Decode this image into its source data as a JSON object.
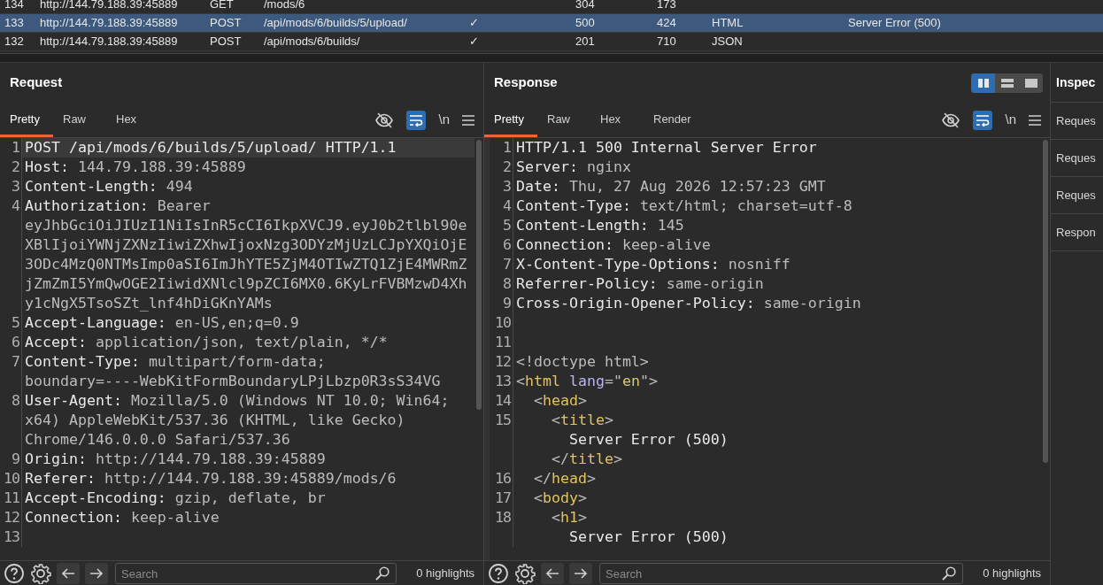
{
  "history": {
    "rows": [
      {
        "number": "134",
        "host": "http://144.79.188.39:45889",
        "method": "GET",
        "url": "/mods/6",
        "status": "304",
        "length": "173",
        "selected": false
      },
      {
        "number": "133",
        "host": "http://144.79.188.39:45889",
        "method": "POST",
        "url": "/api/mods/6/builds/5/upload/",
        "column_5": "✓",
        "status": "500",
        "length": "424",
        "mime": "HTML",
        "title": "Server Error (500)",
        "selected": true
      },
      {
        "number": "132",
        "host": "http://144.79.188.39:45889",
        "method": "POST",
        "url": "/api/mods/6/builds/",
        "column_5": "✓",
        "status": "201",
        "length": "710",
        "mime": "JSON",
        "selected": false
      }
    ]
  },
  "request": {
    "title": "Request",
    "tabs": [
      {
        "label": "Pretty",
        "selected": true
      },
      {
        "label": "Raw",
        "selected": false
      },
      {
        "label": "Hex",
        "selected": false
      }
    ],
    "toolbar": {
      "wrap_on": true,
      "newline_label": "\\n"
    },
    "lines": [
      {
        "number": "1",
        "highlighted": true,
        "rows": [
          {
            "parts": [
              {
                "kind": "plain",
                "text": "POST /api/mods/6/builds/5/upload/ HTTP/1.1"
              }
            ]
          }
        ]
      },
      {
        "number": "2",
        "highlighted": false,
        "rows": [
          {
            "parts": [
              {
                "kind": "name",
                "text": "Host: "
              },
              {
                "kind": "value",
                "text": "144.79.188.39:45889"
              }
            ]
          }
        ]
      },
      {
        "number": "3",
        "highlighted": false,
        "rows": [
          {
            "parts": [
              {
                "kind": "name",
                "text": "Content-Length: "
              },
              {
                "kind": "value",
                "text": "494"
              }
            ]
          }
        ]
      },
      {
        "number": "4",
        "highlighted": false,
        "rows": [
          {
            "parts": [
              {
                "kind": "name",
                "text": "Authorization: "
              },
              {
                "kind": "value",
                "text": "Bearer"
              }
            ]
          },
          {
            "parts": [
              {
                "kind": "value",
                "text": "eyJhbGciOiJIUzI1NiIsInR5cCI6IkpXVCJ9.eyJ0b2tlbl90e"
              }
            ]
          },
          {
            "parts": [
              {
                "kind": "value",
                "text": "XBlIjoiYWNjZXNzIiwiZXhwIjoxNzg3ODYzMjUzLCJpYXQiOjE"
              }
            ]
          },
          {
            "parts": [
              {
                "kind": "value",
                "text": "3ODc4MzQ0NTMsImp0aSI6ImJhYTE5ZjM4OTIwZTQ1ZjE4MWRmZ"
              }
            ]
          },
          {
            "parts": [
              {
                "kind": "value",
                "text": "jZmZmI5YmQwOGE2IiwidXNlcl9pZCI6MX0.6KyLrFVBMzwD4Xh"
              }
            ]
          },
          {
            "parts": [
              {
                "kind": "value",
                "text": "y1cNgX5TsoSZt_lnf4hDiGKnYAMs"
              }
            ]
          }
        ]
      },
      {
        "number": "5",
        "highlighted": false,
        "rows": [
          {
            "parts": [
              {
                "kind": "name",
                "text": "Accept-Language: "
              },
              {
                "kind": "value",
                "text": "en-US,en;q=0.9"
              }
            ]
          }
        ]
      },
      {
        "number": "6",
        "highlighted": false,
        "rows": [
          {
            "parts": [
              {
                "kind": "name",
                "text": "Accept: "
              },
              {
                "kind": "value",
                "text": "application/json, text/plain, */*"
              }
            ]
          }
        ]
      },
      {
        "number": "7",
        "highlighted": false,
        "rows": [
          {
            "parts": [
              {
                "kind": "name",
                "text": "Content-Type: "
              },
              {
                "kind": "value",
                "text": "multipart/form-data;"
              }
            ]
          },
          {
            "parts": [
              {
                "kind": "value",
                "text": "boundary=----WebKitFormBoundaryLPjLbzp0R3sS34VG"
              }
            ]
          }
        ]
      },
      {
        "number": "8",
        "highlighted": false,
        "rows": [
          {
            "parts": [
              {
                "kind": "name",
                "text": "User-Agent: "
              },
              {
                "kind": "value",
                "text": "Mozilla/5.0 (Windows NT 10.0; Win64;"
              }
            ]
          },
          {
            "parts": [
              {
                "kind": "value",
                "text": "x64) AppleWebKit/537.36 (KHTML, like Gecko)"
              }
            ]
          },
          {
            "parts": [
              {
                "kind": "value",
                "text": "Chrome/146.0.0.0 Safari/537.36"
              }
            ]
          }
        ]
      },
      {
        "number": "9",
        "highlighted": false,
        "rows": [
          {
            "parts": [
              {
                "kind": "name",
                "text": "Origin: "
              },
              {
                "kind": "value",
                "text": "http://144.79.188.39:45889"
              }
            ]
          }
        ]
      },
      {
        "number": "10",
        "highlighted": false,
        "rows": [
          {
            "parts": [
              {
                "kind": "name",
                "text": "Referer: "
              },
              {
                "kind": "value",
                "text": "http://144.79.188.39:45889/mods/6"
              }
            ]
          }
        ]
      },
      {
        "number": "11",
        "highlighted": false,
        "rows": [
          {
            "parts": [
              {
                "kind": "name",
                "text": "Accept-Encoding: "
              },
              {
                "kind": "value",
                "text": "gzip, deflate, br"
              }
            ]
          }
        ]
      },
      {
        "number": "12",
        "highlighted": false,
        "rows": [
          {
            "parts": [
              {
                "kind": "name",
                "text": "Connection: "
              },
              {
                "kind": "value",
                "text": "keep-alive"
              }
            ]
          }
        ]
      },
      {
        "number": "13",
        "highlighted": false,
        "rows": [
          {}
        ]
      }
    ],
    "search": {
      "placeholder": "Search"
    },
    "highlights": "0 highlights"
  },
  "response": {
    "title": "Response",
    "layout_options": [
      {
        "kind": "columns",
        "selected": true
      },
      {
        "kind": "rows",
        "selected": false
      },
      {
        "kind": "single",
        "selected": false
      }
    ],
    "tabs": [
      {
        "label": "Pretty",
        "selected": true
      },
      {
        "label": "Raw",
        "selected": false
      },
      {
        "label": "Hex",
        "selected": false
      },
      {
        "label": "Render",
        "selected": false
      }
    ],
    "toolbar": {
      "wrap_on": true,
      "newline_label": "\\n"
    },
    "lines": [
      {
        "number": "1",
        "highlighted": false,
        "rows": [
          {
            "parts": [
              {
                "kind": "plain",
                "text": "HTTP/1.1 500 Internal Server Error"
              }
            ]
          }
        ]
      },
      {
        "number": "2",
        "highlighted": false,
        "rows": [
          {
            "parts": [
              {
                "kind": "name",
                "text": "Server: "
              },
              {
                "kind": "value",
                "text": "nginx"
              }
            ]
          }
        ]
      },
      {
        "number": "3",
        "highlighted": false,
        "rows": [
          {
            "parts": [
              {
                "kind": "name",
                "text": "Date: "
              },
              {
                "kind": "value",
                "text": "Thu, 27 Aug 2026 12:57:23 GMT"
              }
            ]
          }
        ]
      },
      {
        "number": "4",
        "highlighted": false,
        "rows": [
          {
            "parts": [
              {
                "kind": "name",
                "text": "Content-Type: "
              },
              {
                "kind": "value",
                "text": "text/html; charset=utf-8"
              }
            ]
          }
        ]
      },
      {
        "number": "5",
        "highlighted": false,
        "rows": [
          {
            "parts": [
              {
                "kind": "name",
                "text": "Content-Length: "
              },
              {
                "kind": "value",
                "text": "145"
              }
            ]
          }
        ]
      },
      {
        "number": "6",
        "highlighted": false,
        "rows": [
          {
            "parts": [
              {
                "kind": "name",
                "text": "Connection: "
              },
              {
                "kind": "value",
                "text": "keep-alive"
              }
            ]
          }
        ]
      },
      {
        "number": "7",
        "highlighted": false,
        "rows": [
          {
            "parts": [
              {
                "kind": "name",
                "text": "X-Content-Type-Options: "
              },
              {
                "kind": "value",
                "text": "nosniff"
              }
            ]
          }
        ]
      },
      {
        "number": "8",
        "highlighted": false,
        "rows": [
          {
            "parts": [
              {
                "kind": "name",
                "text": "Referrer-Policy: "
              },
              {
                "kind": "value",
                "text": "same-origin"
              }
            ]
          }
        ]
      },
      {
        "number": "9",
        "highlighted": false,
        "rows": [
          {
            "parts": [
              {
                "kind": "name",
                "text": "Cross-Origin-Opener-Policy: "
              },
              {
                "kind": "value",
                "text": "same-origin"
              }
            ]
          }
        ]
      },
      {
        "number": "10",
        "highlighted": false,
        "rows": [
          {}
        ]
      },
      {
        "number": "11",
        "highlighted": false,
        "rows": [
          {}
        ]
      },
      {
        "number": "12",
        "highlighted": false,
        "rows": [
          {
            "parts": [
              {
                "kind": "punct",
                "text": "<!doctype html>"
              }
            ]
          }
        ]
      },
      {
        "number": "13",
        "highlighted": false,
        "rows": [
          {
            "parts": [
              {
                "kind": "punct",
                "text": "<"
              },
              {
                "kind": "tag",
                "text": "html"
              },
              {
                "kind": "attr",
                "text": " lang"
              },
              {
                "kind": "punct",
                "text": "=\""
              },
              {
                "kind": "string",
                "text": "en"
              },
              {
                "kind": "punct",
                "text": "\">"
              }
            ]
          }
        ]
      },
      {
        "number": "14",
        "highlighted": false,
        "rows": [
          {
            "parts": [
              {
                "kind": "punct",
                "text": "  <"
              },
              {
                "kind": "tag",
                "text": "head"
              },
              {
                "kind": "punct",
                "text": ">"
              }
            ]
          }
        ]
      },
      {
        "number": "15",
        "highlighted": false,
        "rows": [
          {
            "parts": [
              {
                "kind": "punct",
                "text": "    <"
              },
              {
                "kind": "tag",
                "text": "title"
              },
              {
                "kind": "punct",
                "text": ">"
              }
            ]
          },
          {
            "parts": [
              {
                "kind": "plain",
                "text": "      Server Error (500)"
              }
            ]
          },
          {
            "parts": [
              {
                "kind": "punct",
                "text": "    </"
              },
              {
                "kind": "tag",
                "text": "title"
              },
              {
                "kind": "punct",
                "text": ">"
              }
            ]
          }
        ]
      },
      {
        "number": "16",
        "highlighted": false,
        "rows": [
          {
            "parts": [
              {
                "kind": "punct",
                "text": "  </"
              },
              {
                "kind": "tag",
                "text": "head"
              },
              {
                "kind": "punct",
                "text": ">"
              }
            ]
          }
        ]
      },
      {
        "number": "17",
        "highlighted": false,
        "rows": [
          {
            "parts": [
              {
                "kind": "punct",
                "text": "  <"
              },
              {
                "kind": "tag",
                "text": "body"
              },
              {
                "kind": "punct",
                "text": ">"
              }
            ]
          }
        ]
      },
      {
        "number": "18",
        "highlighted": false,
        "rows": [
          {
            "parts": [
              {
                "kind": "punct",
                "text": "    <"
              },
              {
                "kind": "tag",
                "text": "h1"
              },
              {
                "kind": "punct",
                "text": ">"
              }
            ]
          },
          {
            "parts": [
              {
                "kind": "plain",
                "text": "      Server Error (500)"
              }
            ]
          }
        ]
      }
    ],
    "search": {
      "placeholder": "Search"
    },
    "highlights": "0 highlights"
  },
  "inspector": {
    "title": "Inspec",
    "items": [
      "Reques",
      "Reques",
      "Reques",
      "Respon"
    ]
  }
}
